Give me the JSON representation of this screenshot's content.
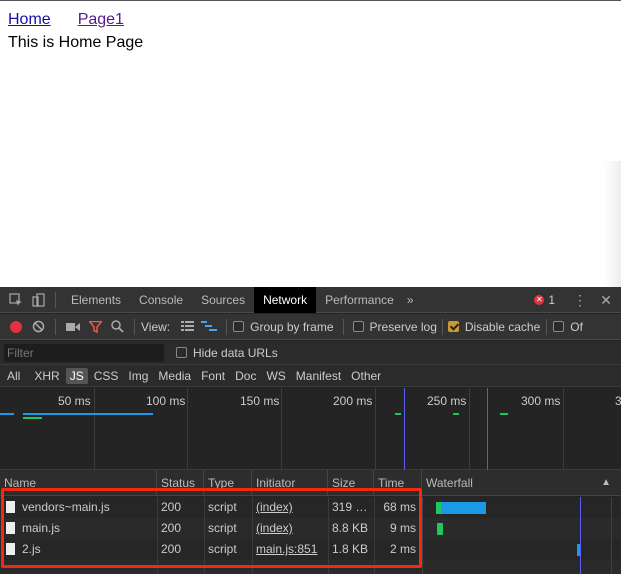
{
  "page": {
    "nav": [
      {
        "label": "Home"
      },
      {
        "label": "Page1"
      }
    ],
    "text": "This is Home Page"
  },
  "devtools": {
    "tabs": [
      "Elements",
      "Console",
      "Sources",
      "Network",
      "Performance"
    ],
    "active_tab": "Network",
    "more_tabs_glyph": "»",
    "error_count": "1",
    "toolbar": {
      "view_label": "View:",
      "group_by_frame": "Group by frame",
      "preserve_log": "Preserve log",
      "disable_cache": "Disable cache",
      "offline_truncated": "Of",
      "disable_cache_checked": true
    },
    "filter": {
      "placeholder": "Filter",
      "hide_data_urls": "Hide data URLs"
    },
    "types": [
      "All",
      "XHR",
      "JS",
      "CSS",
      "Img",
      "Media",
      "Font",
      "Doc",
      "WS",
      "Manifest",
      "Other"
    ],
    "active_type": "JS",
    "overview_ticks": [
      "50 ms",
      "100 ms",
      "150 ms",
      "200 ms",
      "250 ms",
      "300 ms",
      "3"
    ],
    "columns": {
      "name": "Name",
      "status": "Status",
      "type": "Type",
      "initiator": "Initiator",
      "size": "Size",
      "time": "Time",
      "waterfall": "Waterfall"
    },
    "requests": [
      {
        "name": "vendors~main.js",
        "status": "200",
        "type": "script",
        "initiator": "(index)",
        "size": "319 …",
        "time": "68 ms"
      },
      {
        "name": "main.js",
        "status": "200",
        "type": "script",
        "initiator": "(index)",
        "size": "8.8 KB",
        "time": "9 ms"
      },
      {
        "name": "2.js",
        "status": "200",
        "type": "script",
        "initiator": "main.js:851",
        "size": "1.8 KB",
        "time": "2 ms"
      }
    ],
    "colors": {
      "accent_blue": "#1a9ae5",
      "accent_green": "#22c55e",
      "highlight_red": "#f32a0f",
      "record_red": "#e0343d"
    }
  }
}
